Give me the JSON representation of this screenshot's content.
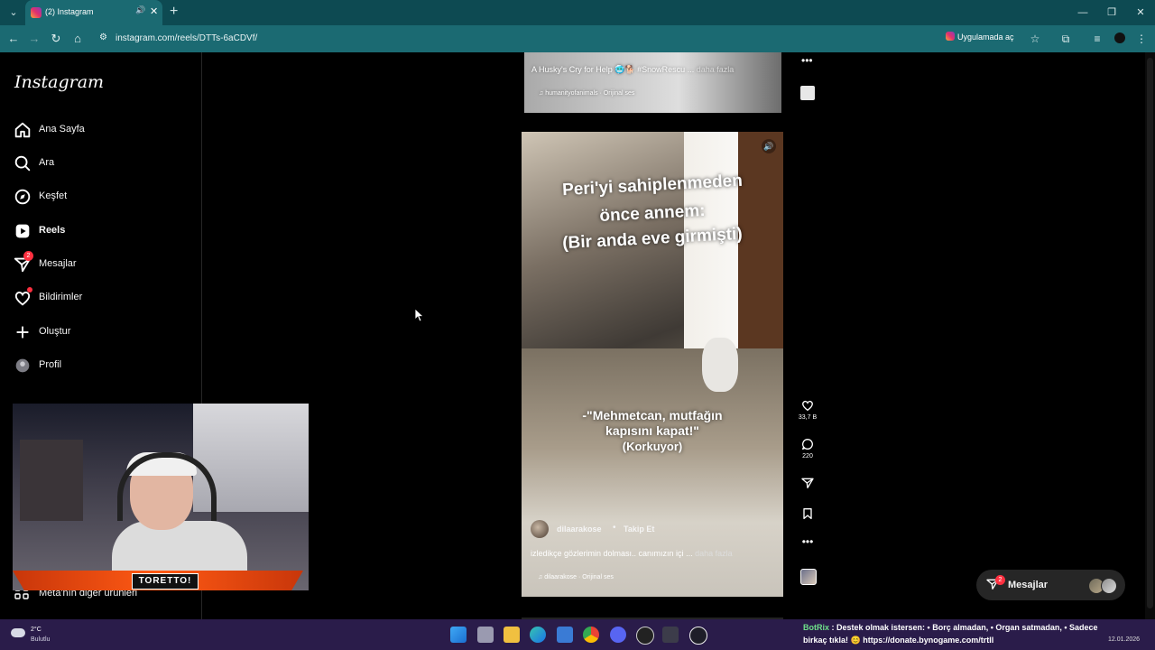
{
  "browser": {
    "tab_title": "(2) Instagram",
    "url": "instagram.com/reels/DTTs-6aCDVf/",
    "open_in_app": "Uygulamada aç"
  },
  "sidebar": {
    "logo": "Instagram",
    "items": [
      {
        "label": "Ana Sayfa",
        "icon": "home-icon"
      },
      {
        "label": "Ara",
        "icon": "search-icon"
      },
      {
        "label": "Keşfet",
        "icon": "explore-icon"
      },
      {
        "label": "Reels",
        "icon": "reels-icon",
        "active": true
      },
      {
        "label": "Mesajlar",
        "icon": "messages-icon",
        "badge": "2"
      },
      {
        "label": "Bildirimler",
        "icon": "heart-icon",
        "dot": true
      },
      {
        "label": "Oluştur",
        "icon": "plus-icon"
      },
      {
        "label": "Profil",
        "icon": "avatar"
      }
    ],
    "more": "Meta'nın diğer ürünleri"
  },
  "webcam": {
    "tag": "TORETTO!"
  },
  "previous_reel": {
    "caption": "A Husky's Cry for Help 🥶🐕 #SnowRescu",
    "ellipsis": "...",
    "more": "daha fazla",
    "audio": "humanityofanimals · Orijinal ses"
  },
  "reel": {
    "overlay_title": [
      "Peri'yi sahiplenmeden",
      "önce annem:",
      "(Bir anda eve girmişti)"
    ],
    "overlay_quote": [
      "-\"Mehmetcan, mutfağın",
      "kapısını kapat!\"",
      "(Korkuyor)"
    ],
    "username": "dilaarakose",
    "separator": "•",
    "follow": "Takip Et",
    "caption": "izledikçe gözlerimin dolması.. canımızın içi",
    "ellipsis": "...",
    "more": "daha fazla",
    "audio": "dilaarakose · Orijinal ses",
    "likes": "33,7 B",
    "comments": "220"
  },
  "messages_pill": {
    "label": "Mesajlar",
    "badge": "2"
  },
  "taskbar": {
    "temp": "2°C",
    "condition": "Bulutlu",
    "ticker_name": "BotRix",
    "ticker_line1": " : Destek olmak istersen: • Borç almadan, • Organ satmadan, • Sadece",
    "ticker_line2": "birkaç tıkla! 😊 https://donate.bynogame.com/trtll",
    "date": "12.01.2026"
  },
  "colors": {
    "accent_badge": "#ff3040",
    "chrome": "#1b6a72",
    "taskbar": "#2a1c4a"
  }
}
